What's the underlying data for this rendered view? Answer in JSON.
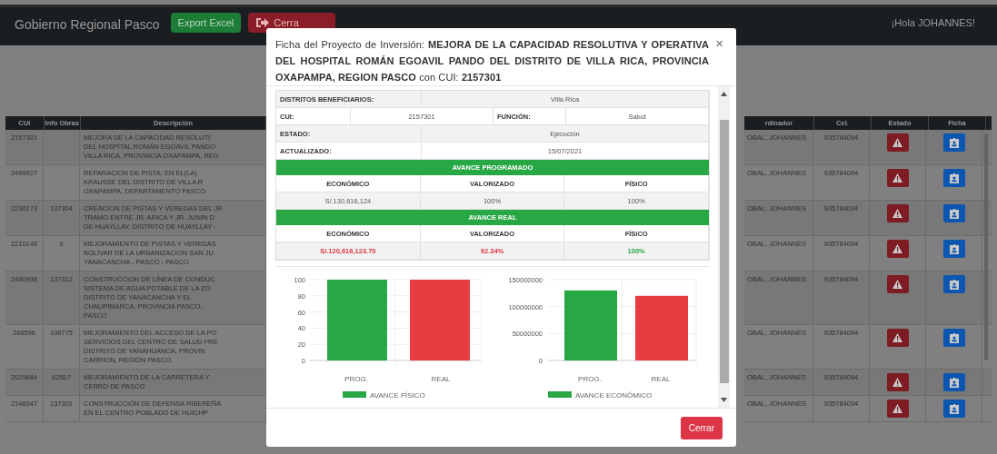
{
  "header": {
    "brand": "Gobierno Regional Pasco",
    "greeting": "¡Hola JOHANNES!",
    "buttons": [
      {
        "label": "Export Excel",
        "kind": "export"
      },
      {
        "label": "Cerra",
        "kind": "logout"
      }
    ]
  },
  "table": {
    "left_columns": [
      "CUI",
      "Info Obras",
      "Descripción"
    ],
    "right_columns": [
      "rdinador",
      "Cel.",
      "Estado",
      "Ficha"
    ],
    "rows": [
      {
        "cui": "2157301",
        "info_obras": "",
        "descripcion": "MEJORA DE LA CAPACIDAD RESOLUTI\nDEL HOSPITAL ROMÁN EGOAVIL PANDO\nVILLA RICA, PROVINCIA OXAPAMPA, REG",
        "coordinador": "OBAL, JOHANNES",
        "cel": "935784094"
      },
      {
        "cui": "2499927",
        "info_obras": "",
        "descripcion": "REPARACION DE PISTA; EN EL(LA)\nKRAUSSE DEL DISTRITO DE VILLA R\nOXAPAMPA, DEPARTAMENTO PASCO",
        "coordinador": "OBAL, JOHANNES",
        "cel": "935784094"
      },
      {
        "cui": "2236173",
        "info_obras": "137304",
        "descripcion": "CREACION DE PISTAS Y VEREDAS DEL JR\nTRAMO ENTRE JR. ARICA Y JR. JUNIN D\nDE HUAYLLAY, DISTRITO DE HUAYLLAY -",
        "coordinador": "OBAL, JOHANNES",
        "cel": "935784094"
      },
      {
        "cui": "2210146",
        "info_obras": "0",
        "descripcion": "MEJORAMIENTO DE PISTAS Y VEREDAS\nBOLIVAR DE LA URBANIZACION SAN JU\nYANACANCHA - PASCO - PASCO",
        "coordinador": "OBAL, JOHANNES",
        "cel": "935784094"
      },
      {
        "cui": "2490938",
        "info_obras": "137312",
        "descripcion": "CONSTRUCCION DE LÍNEA DE CONDUC\nSISTEMA DE AGUA POTABLE DE LA ZO\nDISTRITO DE YANACANCHA Y EL\nCHAUPIMARCA, PROVINCIA PASCO,\nPASCO",
        "coordinador": "OBAL, JOHANNES",
        "cel": "935784094"
      },
      {
        "cui": "268596",
        "info_obras": "108775",
        "descripcion": "MEJORAMIENTO DEL ACCESO DE LA PO\nSERVICIOS DEL CENTRO DE SALUD FRE\nDISTRITO DE YANAHUANCA, PROVIN\nCARRION, REGION PASCO.",
        "coordinador": "OBAL, JOHANNES",
        "cel": "935784094"
      },
      {
        "cui": "2029684",
        "info_obras": "82507",
        "descripcion": "MEJORAMIENTO DE LA CARRETERA Y\nCERRO DE PASCO",
        "coordinador": "OBAL, JOHANNES",
        "cel": "935784094"
      },
      {
        "cui": "2148347",
        "info_obras": "137301",
        "descripcion": "CONSTRUCCIÓN DE DEFENSA RIBEREÑA\nEN EL CENTRO POBLADO DE HUICHP",
        "coordinador": "OBAL, JOHANNES",
        "cel": "935784094"
      }
    ]
  },
  "modal": {
    "title": "Ficha del Proyecto de Inversión: **MEJORA DE LA CAPACIDAD RESOLUTIVA Y OPERATIVA DEL HOSPITAL ROMÁN EGOAVIL PANDO DEL DISTRITO DE VILLA RICA, PROVINCIA OXAPAMPA, REGION PASCO** con CUI: **2157301**",
    "close": "×",
    "info": {
      "distritos_label": "DISTRITOS BENEFICIARIOS:",
      "distritos": "Villa Rica",
      "cui_label": "CUI:",
      "cui": "2157301",
      "funcion_label": "FUNCIÓN:",
      "funcion": "Salud",
      "estado_label": "ESTADO:",
      "estado": "Ejecución",
      "actualizado_label": "ACTUALIZADO:",
      "actualizado": "15/07/2021"
    },
    "sections": [
      {
        "title": "AVANCE PROGRAMADO",
        "headers": [
          "ECONÓMICO",
          "VALORIZADO",
          "FÍSICO"
        ],
        "values": [
          {
            "text": "S/.130,616,124"
          },
          {
            "text": "100%"
          },
          {
            "text": "100%"
          }
        ]
      },
      {
        "title": "AVANCE REAL",
        "headers": [
          "ECONÓMICO",
          "VALORIZADO",
          "FÍSICO"
        ],
        "values": [
          {
            "text": "S/.120,616,123.70",
            "color": "#dc3545"
          },
          {
            "text": "92.34%",
            "color": "#dc3545"
          },
          {
            "text": "100%",
            "color": "#28a745"
          }
        ]
      }
    ],
    "charts": [
      {
        "chart_data": {
          "type": "bar",
          "categories": [
            "PROG.",
            "REAL"
          ],
          "series": [
            {
              "name": "AVANCE FÍSICO",
              "color": "#28a745",
              "colors": [
                "#28a745",
                "#e53d40"
              ],
              "values": [
                100,
                100
              ]
            }
          ],
          "grid": true,
          "ylim": [
            0,
            100
          ],
          "yticks": [
            0,
            20,
            40,
            60,
            80,
            100
          ]
        }
      },
      {
        "chart_data": {
          "type": "bar",
          "categories": [
            "PROG.",
            "REAL"
          ],
          "series": [
            {
              "name": "AVANCE ECONÓMICO",
              "color": "#28a745",
              "colors": [
                "#28a745",
                "#e53d40"
              ],
              "values": [
                130000000,
                120000000
              ]
            }
          ],
          "grid": true,
          "ylim": [
            0,
            150000000
          ],
          "yticks": [
            0,
            50000000,
            100000000,
            150000000
          ]
        }
      }
    ],
    "close_button": "Cerrar"
  }
}
